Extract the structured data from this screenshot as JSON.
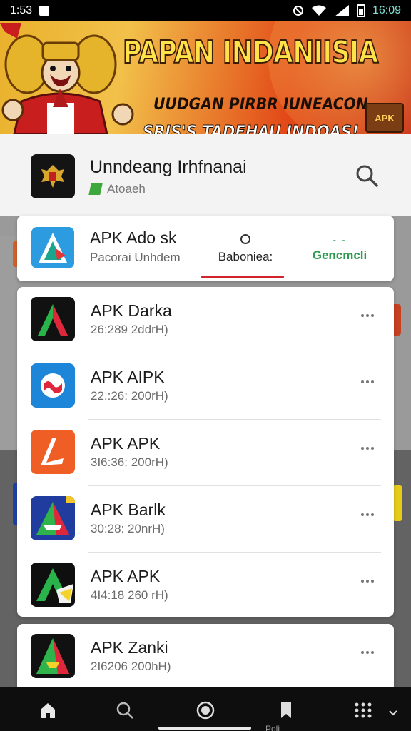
{
  "status_bar": {
    "time_left": "1:53",
    "time_right": "16:09"
  },
  "banner": {
    "title": "PAPAN INDANIISIA",
    "subtitle_1": "UUDGAN PIRBR IUNEACON",
    "subtitle_2": "SRIS'S TADEHAU INDOAS!",
    "badge": "APK"
  },
  "app_header": {
    "name": "Unndeang Irhfnanai",
    "sub_label": "Atoaeh",
    "search_icon": "search-icon"
  },
  "featured": {
    "name": "APK Ado sk",
    "sub": "Pacorai Unhdem",
    "tab_active": "Baboniea:",
    "tab_secondary": "Gencmcli",
    "accent_color": "#d3232a",
    "secondary_color": "#2c9a4f"
  },
  "apps": [
    {
      "name": "APK Darka",
      "date": "26:289 2ddrH)",
      "icon": "apk-a-red-green-icon"
    },
    {
      "name": "APK AIPK",
      "date": "22.:26: 200rH)",
      "icon": "apk-blue-loop-icon"
    },
    {
      "name": "APK APK",
      "date": "3I6:36: 200rH)",
      "icon": "apk-orange-arrow-icon"
    },
    {
      "name": "APK Barlk",
      "date": "30:28: 20nrH)",
      "icon": "apk-blue-green-triangle-icon"
    },
    {
      "name": "APK APK",
      "date": "4I4:18 260 rH)",
      "icon": "apk-green-black-a-icon"
    },
    {
      "name": "APK Zanki",
      "date": "2I6206 200hH)",
      "icon": "apk-a-green-red-icon"
    }
  ],
  "bottom_nav": {
    "items": [
      "home-icon",
      "search-icon",
      "circle-icon",
      "bookmark-icon",
      "apps-icon"
    ],
    "label_peek": "Poli"
  }
}
